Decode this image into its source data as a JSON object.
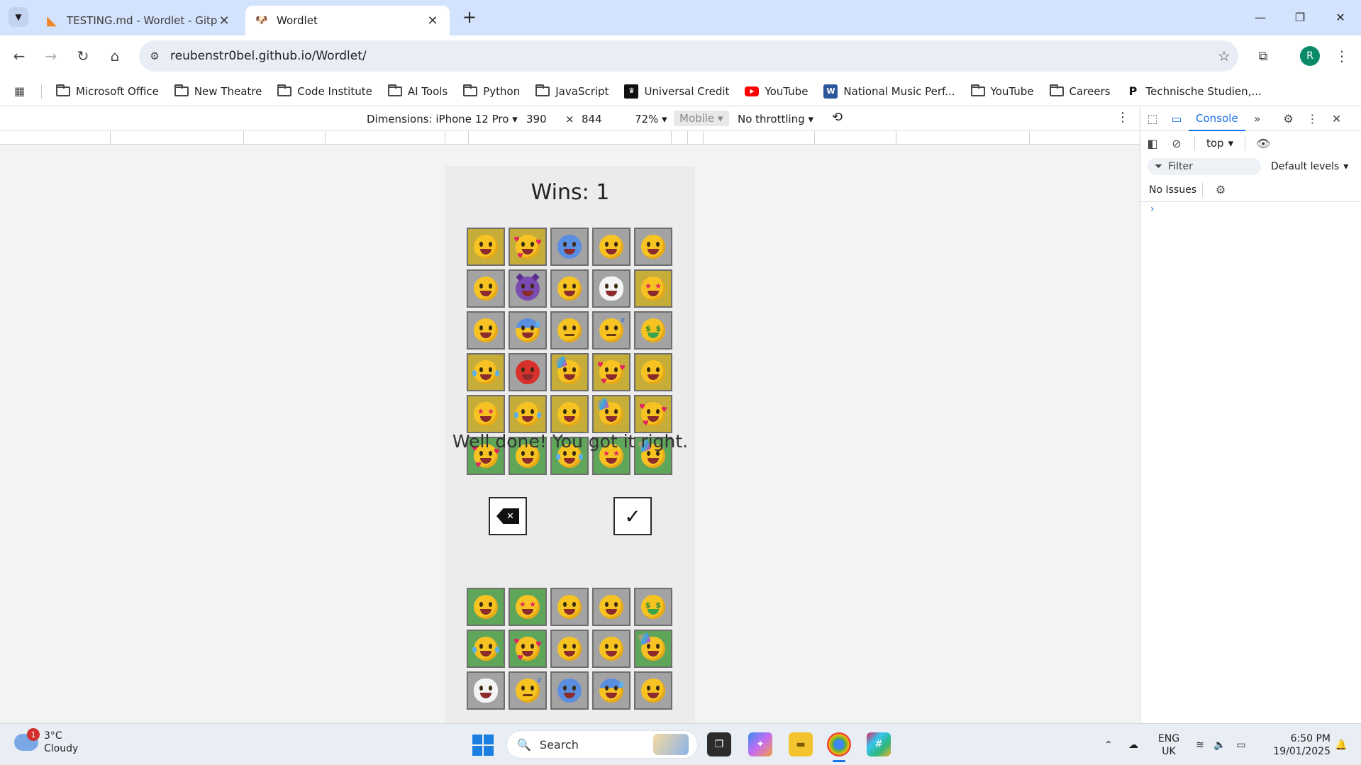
{
  "browser": {
    "tabs": [
      {
        "title": "TESTING.md - Wordlet - Gitpod",
        "icon": "gitpod-icon",
        "active": false
      },
      {
        "title": "Wordlet",
        "icon": "wordlet-favicon",
        "active": true
      }
    ],
    "url": "reubenstr0bel.github.io/Wordlet/",
    "profile_initial": "R",
    "bookmarks": [
      {
        "label": "Microsoft Office",
        "icon": "folder-icon"
      },
      {
        "label": "New Theatre",
        "icon": "folder-icon"
      },
      {
        "label": "Code Institute",
        "icon": "folder-icon"
      },
      {
        "label": "AI Tools",
        "icon": "folder-icon"
      },
      {
        "label": "Python",
        "icon": "folder-icon"
      },
      {
        "label": "JavaScript",
        "icon": "folder-icon"
      },
      {
        "label": "Universal Credit",
        "icon": "universal-credit-icon"
      },
      {
        "label": "YouTube",
        "icon": "youtube-icon"
      },
      {
        "label": "National Music Perf...",
        "icon": "word-icon"
      },
      {
        "label": "YouTube",
        "icon": "folder-icon"
      },
      {
        "label": "Careers",
        "icon": "folder-icon"
      },
      {
        "label": "Technische Studien,...",
        "icon": "ts-icon"
      }
    ]
  },
  "device_toolbar": {
    "dimensions_label": "Dimensions: iPhone 12 Pro",
    "width": "390",
    "times": "×",
    "height": "844",
    "zoom": "72%",
    "mobile": "Mobile",
    "throttling": "No throttling"
  },
  "devtools": {
    "console_tab": "Console",
    "context": "top",
    "filter_placeholder": "Filter",
    "levels": "Default levels",
    "issues": "No Issues",
    "prompt": "›"
  },
  "game": {
    "wins_label": "Wins: 1",
    "message": "Well done! You got it right.",
    "colors": {
      "grey": "#a3a3a3",
      "yellow": "#c6ad3a",
      "green": "#5fa55a"
    },
    "guess_grid": [
      [
        {
          "e": "grinning-face",
          "s": "yellow"
        },
        {
          "e": "smiling-face-with-hearts",
          "s": "yellow"
        },
        {
          "e": "cold-face",
          "s": "grey"
        },
        {
          "e": "tongue-out-face",
          "s": "grey"
        },
        {
          "e": "winking-tongue-face",
          "s": "grey"
        }
      ],
      [
        {
          "e": "pleading-face",
          "s": "grey"
        },
        {
          "e": "devil-face",
          "s": "grey"
        },
        {
          "e": "thinking-face",
          "s": "grey"
        },
        {
          "e": "cloud-face",
          "s": "grey"
        },
        {
          "e": "star-struck-face",
          "s": "yellow"
        }
      ],
      [
        {
          "e": "grimacing-face",
          "s": "grey"
        },
        {
          "e": "anxious-sweat-face",
          "s": "grey"
        },
        {
          "e": "expressionless-face",
          "s": "grey"
        },
        {
          "e": "sleeping-face",
          "s": "grey"
        },
        {
          "e": "money-mouth-face",
          "s": "grey"
        }
      ],
      [
        {
          "e": "tears-of-joy-face",
          "s": "yellow"
        },
        {
          "e": "angry-face",
          "s": "grey"
        },
        {
          "e": "partying-face",
          "s": "yellow"
        },
        {
          "e": "smiling-face-with-hearts",
          "s": "yellow"
        },
        {
          "e": "grinning-face",
          "s": "yellow"
        }
      ],
      [
        {
          "e": "star-struck-face",
          "s": "yellow"
        },
        {
          "e": "tears-of-joy-face",
          "s": "yellow"
        },
        {
          "e": "grinning-face",
          "s": "yellow"
        },
        {
          "e": "partying-face",
          "s": "yellow"
        },
        {
          "e": "smiling-face-with-hearts",
          "s": "yellow"
        }
      ],
      [
        {
          "e": "smiling-face-with-hearts",
          "s": "green"
        },
        {
          "e": "grinning-face",
          "s": "green"
        },
        {
          "e": "tears-of-joy-face",
          "s": "green"
        },
        {
          "e": "star-struck-face",
          "s": "green"
        },
        {
          "e": "partying-face",
          "s": "green"
        }
      ]
    ],
    "keyboard_grid": [
      [
        {
          "e": "grinning-face",
          "s": "green"
        },
        {
          "e": "star-struck-face",
          "s": "green"
        },
        {
          "e": "winking-tongue-face",
          "s": "grey"
        },
        {
          "e": "grimacing-face",
          "s": "grey"
        },
        {
          "e": "money-mouth-face",
          "s": "grey"
        }
      ],
      [
        {
          "e": "tears-of-joy-face",
          "s": "green"
        },
        {
          "e": "smiling-face-with-hearts",
          "s": "green"
        },
        {
          "e": "thinking-face",
          "s": "grey"
        },
        {
          "e": "tongue-out-face",
          "s": "grey"
        },
        {
          "e": "partying-face",
          "s": "green"
        }
      ],
      [
        {
          "e": "cloud-face",
          "s": "grey"
        },
        {
          "e": "sleeping-face",
          "s": "grey"
        },
        {
          "e": "cold-face",
          "s": "grey"
        },
        {
          "e": "anxious-sweat-face",
          "s": "grey"
        },
        {
          "e": "pleading-face",
          "s": "grey"
        }
      ]
    ],
    "backspace_icon": "backspace-icon",
    "submit_icon": "check-icon"
  },
  "taskbar": {
    "weather_temp": "3°C",
    "weather_desc": "Cloudy",
    "weather_badge": "1",
    "search_label": "Search",
    "lang_top": "ENG",
    "lang_bottom": "UK",
    "time": "6:50 PM",
    "date": "19/01/2025"
  }
}
